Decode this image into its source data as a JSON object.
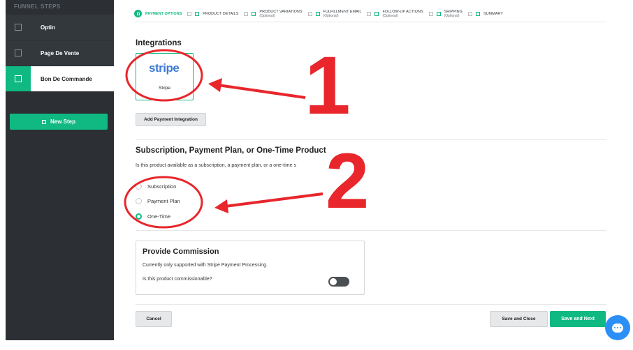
{
  "sidebar": {
    "header": "FUNNEL STEPS",
    "steps": [
      {
        "label": "Optin"
      },
      {
        "label": "Page De Vente"
      },
      {
        "label": "Bon De Commande"
      }
    ],
    "new_step_label": "New Step"
  },
  "progress": {
    "steps": [
      {
        "label": "PAYMENT OPTIONS",
        "sub": "",
        "state": "active"
      },
      {
        "label": "PRODUCT DETAILS",
        "sub": ""
      },
      {
        "label": "PRODUCT VARIATIONS",
        "sub": "(Optional)"
      },
      {
        "label": "FULFILLMENT EMAIL",
        "sub": "(Optional)"
      },
      {
        "label": "FOLLOW-UP ACTIONS",
        "sub": "(Optional)"
      },
      {
        "label": "SHIPPING",
        "sub": "(Optional)"
      },
      {
        "label": "SUMMARY",
        "sub": ""
      }
    ]
  },
  "integrations": {
    "title": "Integrations",
    "card_logo": "stripe",
    "card_label": "Stripe",
    "add_button": "Add Payment Integration"
  },
  "product_type": {
    "title": "Subscription, Payment Plan, or One-Time Product",
    "description": "Is this product available as a subscription, a payment plan, or a one-time s",
    "options": [
      "Subscription",
      "Payment Plan",
      "One-Time"
    ],
    "selected": "One-Time"
  },
  "commission": {
    "title": "Provide Commission",
    "text": "Currently only supported with Stripe Payment Processing.",
    "question": "Is this product commissionable?",
    "toggle_on": false
  },
  "footer_buttons": {
    "cancel": "Cancel",
    "save_close": "Save and Close",
    "save_next": "Save and Next"
  },
  "annotations": {
    "one": "1",
    "two": "2",
    "color": "#e8262b"
  },
  "colors": {
    "accent": "#10b981",
    "sidebar_bg": "#2c3035",
    "stripe_blue": "#3d7ad6"
  }
}
